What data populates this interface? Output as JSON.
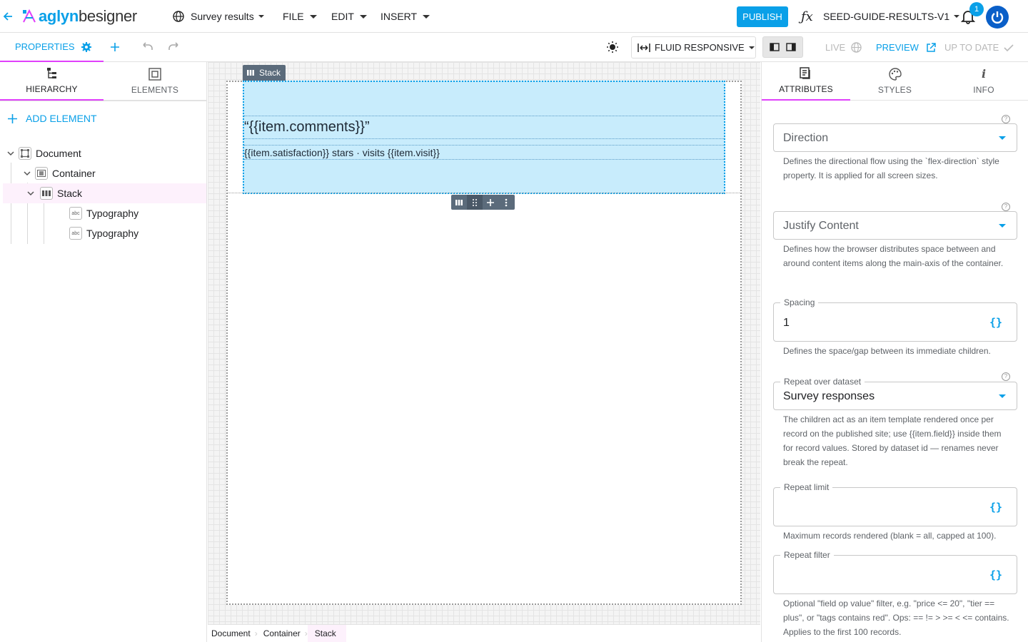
{
  "colors": {
    "accent": "#0aa0e8",
    "brand_pink": "#e040fb",
    "selection_fill": "#c8ecfc",
    "tree_selected_bg": "#fdf1fc"
  },
  "topbar": {
    "back_icon": "arrow-left-icon",
    "logo_text": "aglynbesigner",
    "logo_a": "aglyn",
    "logo_b": "besigner",
    "site_name": "Survey results",
    "menus": [
      "FILE",
      "EDIT",
      "INSERT"
    ],
    "publish_label": "PUBLISH",
    "fx_label": "ƒx",
    "page_name": "SEED-GUIDE-RESULTS-V1",
    "notification_count": "1"
  },
  "subbar": {
    "properties_label": "PROPERTIES",
    "layout_mode": "FLUID RESPONSIVE",
    "live_label": "LIVE",
    "preview_label": "PREVIEW",
    "status_label": "UP TO DATE"
  },
  "left_panel": {
    "tabs": [
      {
        "label": "HIERARCHY",
        "icon": "hierarchy-icon"
      },
      {
        "label": "ELEMENTS",
        "icon": "elements-icon"
      }
    ],
    "add_element_label": "ADD ELEMENT",
    "tree": [
      {
        "label": "Document",
        "icon": "document-icon",
        "expanded": true
      },
      {
        "label": "Container",
        "icon": "container-icon",
        "expanded": true
      },
      {
        "label": "Stack",
        "icon": "stack-icon",
        "expanded": true,
        "selected": true
      },
      {
        "label": "Typography",
        "icon": "typography-icon"
      },
      {
        "label": "Typography",
        "icon": "typography-icon"
      }
    ]
  },
  "canvas": {
    "stack_tag": "Stack",
    "comments_text": "“{{item.comments}}”",
    "satisfaction_text": "{{item.satisfaction}} stars · visits {{item.visit}}",
    "breadcrumb": [
      "Document",
      "Container",
      "Stack"
    ]
  },
  "right_panel": {
    "tabs": [
      {
        "label": "ATTRIBUTES",
        "icon": "attributes-icon"
      },
      {
        "label": "STYLES",
        "icon": "palette-icon"
      },
      {
        "label": "INFO",
        "icon": "info-icon"
      }
    ],
    "direction": {
      "label": "Direction",
      "help": "Defines the directional flow using the `flex-direction` style property. It is applied for all screen sizes."
    },
    "justify": {
      "label": "Justify Content",
      "help": "Defines how the browser distributes space between and around content items along the main-axis of the container."
    },
    "spacing": {
      "label": "Spacing",
      "value": "1",
      "help": "Defines the space/gap between its immediate children."
    },
    "repeat": {
      "label": "Repeat over dataset",
      "value": "Survey responses",
      "help": "The children act as an item template rendered once per record on the published site; use {{item.field}} inside them for record values. Stored by dataset id — renames never break the repeat."
    },
    "repeat_limit": {
      "label": "Repeat limit",
      "value": "",
      "help": "Maximum records rendered (blank = all, capped at 100)."
    },
    "repeat_filter": {
      "label": "Repeat filter",
      "value": "",
      "help": "Optional \"field op value\" filter, e.g. \"price <= 20\", \"tier == plus\", or \"tags contains red\". Ops: == != > >= < <= contains. Applies to the first 100 records."
    }
  }
}
